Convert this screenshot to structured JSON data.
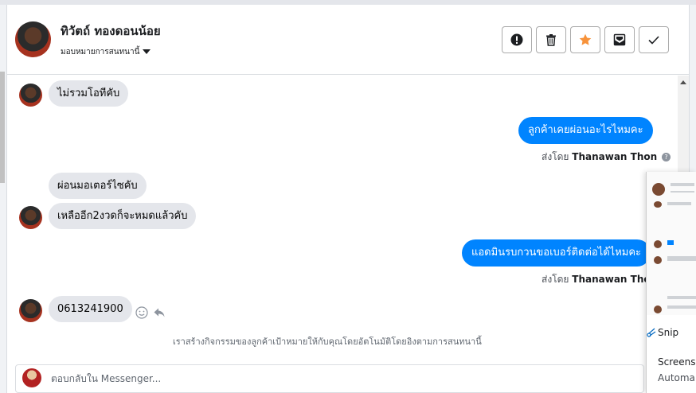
{
  "header": {
    "contact_name": "ทิวัตถ์ ทองดอนน้อย",
    "assign_label": "มอบหมายการสนทนานี้"
  },
  "actions": [
    {
      "name": "spam-button",
      "icon": "exclamation-icon"
    },
    {
      "name": "delete-button",
      "icon": "trash-icon"
    },
    {
      "name": "star-button",
      "icon": "star-icon"
    },
    {
      "name": "mark-unread-button",
      "icon": "envelope-icon"
    },
    {
      "name": "done-button",
      "icon": "check-icon"
    }
  ],
  "messages": {
    "m1": "ไม่รวมโอทีคับ",
    "m2": "ลูกค้าเคยผ่อนอะไรไหมคะ",
    "m2_sent_prefix": "ส่งโดย",
    "m2_sent_by": "Thanawan Thon",
    "m3": "ผ่อนมอเตอร์ไซคับ",
    "m4": "เหลืออีก2งวดก็จะหมดแล้วคับ",
    "m5": "แอดมินรบกวนขอเบอร์ติดต่อได้ไหมคะ",
    "m5_sent_prefix": "ส่งโดย",
    "m5_sent_by": "Thanawan Thon",
    "m6": "0613241900"
  },
  "notice": "เราสร้างกิจกรรมของลูกค้าเป้าหมายให้กับคุณโดยอัตโนมัติโดยอิงตามการสนทนานี้",
  "composer": {
    "placeholder": "ตอบกลับใน Messenger..."
  },
  "overlay": {
    "snip_label": "Snip",
    "screens_label": "Screens",
    "auto_label": "Automa"
  },
  "colors": {
    "outgoing_bubble": "#0084ff",
    "incoming_bubble": "#e4e6eb",
    "star": "#f7923a"
  }
}
